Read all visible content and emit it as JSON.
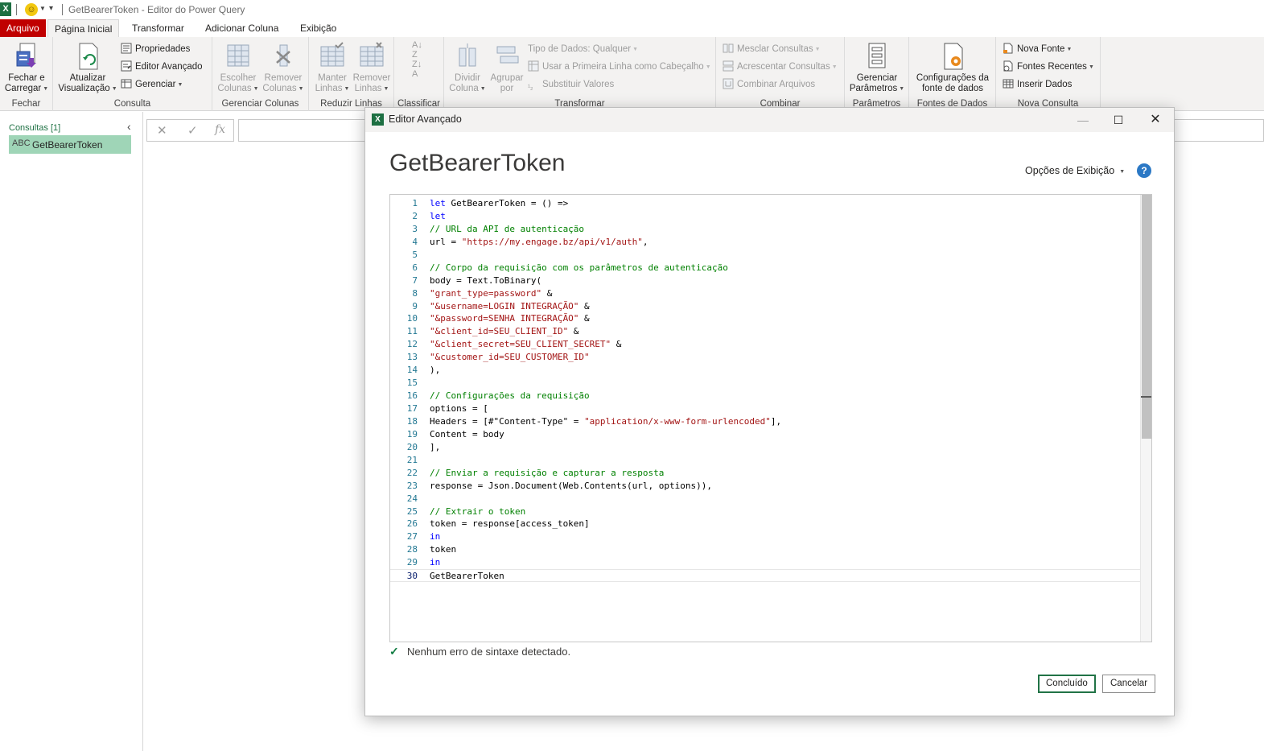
{
  "window": {
    "title": "GetBearerToken - Editor do Power Query",
    "app_icon": "X"
  },
  "tabs": [
    {
      "label": "Arquivo"
    },
    {
      "label": "Página Inicial"
    },
    {
      "label": "Transformar"
    },
    {
      "label": "Adicionar Coluna"
    },
    {
      "label": "Exibição"
    }
  ],
  "ribbon": {
    "fechar": {
      "btn_line1": "Fechar e",
      "btn_line2": "Carregar",
      "group": "Fechar"
    },
    "consulta": {
      "atualizar_line1": "Atualizar",
      "atualizar_line2": "Visualização",
      "propriedades": "Propriedades",
      "editor_avancado": "Editor Avançado",
      "gerenciar": "Gerenciar",
      "group": "Consulta"
    },
    "gerenciar_colunas": {
      "escolher_line1": "Escolher",
      "escolher_line2": "Colunas",
      "remover_line1": "Remover",
      "remover_line2": "Colunas",
      "group": "Gerenciar Colunas"
    },
    "reduzir_linhas": {
      "manter_line1": "Manter",
      "manter_line2": "Linhas",
      "remover_line1": "Remover",
      "remover_line2": "Linhas",
      "group": "Reduzir Linhas"
    },
    "classificar": {
      "group": "Classificar"
    },
    "transformar": {
      "dividir_line1": "Dividir",
      "dividir_line2": "Coluna",
      "agrupar_line1": "Agrupar",
      "agrupar_line2": "por",
      "tipo_dados": "Tipo de Dados: Qualquer",
      "primeira_linha": "Usar a Primeira Linha como Cabeçalho",
      "substituir": "Substituir Valores",
      "group": "Transformar"
    },
    "combinar": {
      "mesclar": "Mesclar Consultas",
      "acrescentar": "Acrescentar Consultas",
      "combinar_arquivos": "Combinar Arquivos",
      "group": "Combinar"
    },
    "parametros": {
      "btn_line1": "Gerenciar",
      "btn_line2": "Parâmetros",
      "group": "Parâmetros"
    },
    "fontes_dados": {
      "btn_line1": "Configurações da",
      "btn_line2": "fonte de dados",
      "group": "Fontes de Dados"
    },
    "nova_consulta": {
      "nova_fonte": "Nova Fonte",
      "fontes_recentes": "Fontes Recentes",
      "inserir_dados": "Inserir Dados",
      "group": "Nova Consulta"
    }
  },
  "queries_pane": {
    "header": "Consultas [1]",
    "type_icon_text": "ABC",
    "items": [
      {
        "name": "GetBearerToken"
      }
    ]
  },
  "formula_bar": {
    "value": ""
  },
  "dialog": {
    "title": "Editor Avançado",
    "heading": "GetBearerToken",
    "view_options": "Opções de Exibição",
    "help": "?",
    "status": "Nenhum erro de sintaxe detectado.",
    "ok_label": "Concluído",
    "cancel_label": "Cancelar"
  },
  "code_lines": [
    [
      {
        "t": "let",
        "c": "kw"
      },
      {
        "t": " GetBearerToken = () =>"
      }
    ],
    [
      {
        "t": "let",
        "c": "kw"
      }
    ],
    [
      {
        "t": "// URL da API de autenticação",
        "c": "cm"
      }
    ],
    [
      {
        "t": "url = "
      },
      {
        "t": "\"https://my.engage.bz/api/v1/auth\"",
        "c": "st"
      },
      {
        "t": ","
      }
    ],
    [],
    [
      {
        "t": "// Corpo da requisição com os parâmetros de autenticação",
        "c": "cm"
      }
    ],
    [
      {
        "t": "body = Text.ToBinary("
      }
    ],
    [
      {
        "t": "\"grant_type=password\"",
        "c": "st"
      },
      {
        "t": " &"
      }
    ],
    [
      {
        "t": "\"&username=LOGIN INTEGRAÇÃO\"",
        "c": "st"
      },
      {
        "t": " &"
      }
    ],
    [
      {
        "t": "\"&password=SENHA INTEGRAÇÃO\"",
        "c": "st"
      },
      {
        "t": " &"
      }
    ],
    [
      {
        "t": "\"&client_id=SEU_CLIENT_ID\"",
        "c": "st"
      },
      {
        "t": " &"
      }
    ],
    [
      {
        "t": "\"&client_secret=SEU_CLIENT_SECRET\"",
        "c": "st"
      },
      {
        "t": " &"
      }
    ],
    [
      {
        "t": "\"&customer_id=SEU_CUSTOMER_ID\"",
        "c": "st"
      }
    ],
    [
      {
        "t": "),"
      }
    ],
    [],
    [
      {
        "t": "// Configurações da requisição",
        "c": "cm"
      }
    ],
    [
      {
        "t": "options = ["
      }
    ],
    [
      {
        "t": "Headers = [#\"Content-Type\" = "
      },
      {
        "t": "\"application/x-www-form-urlencoded\"",
        "c": "st"
      },
      {
        "t": "],"
      }
    ],
    [
      {
        "t": "Content = body"
      }
    ],
    [
      {
        "t": "],"
      }
    ],
    [],
    [
      {
        "t": "// Enviar a requisição e capturar a resposta",
        "c": "cm"
      }
    ],
    [
      {
        "t": "response = Json.Document(Web.Contents(url, options)),"
      }
    ],
    [],
    [
      {
        "t": "// Extrair o token",
        "c": "cm"
      }
    ],
    [
      {
        "t": "token = response[access_token]"
      }
    ],
    [
      {
        "t": "in",
        "c": "kw"
      }
    ],
    [
      {
        "t": "token"
      }
    ],
    [
      {
        "t": "in",
        "c": "kw"
      }
    ],
    [
      {
        "t": "GetBearerToken"
      }
    ]
  ],
  "colors": {
    "file_tab": "#c00000",
    "excel_green": "#217346",
    "keyword": "#0000ff",
    "comment": "#008000",
    "string": "#a31515",
    "line_number": "#237893",
    "selected_query": "#9fd5b7"
  }
}
